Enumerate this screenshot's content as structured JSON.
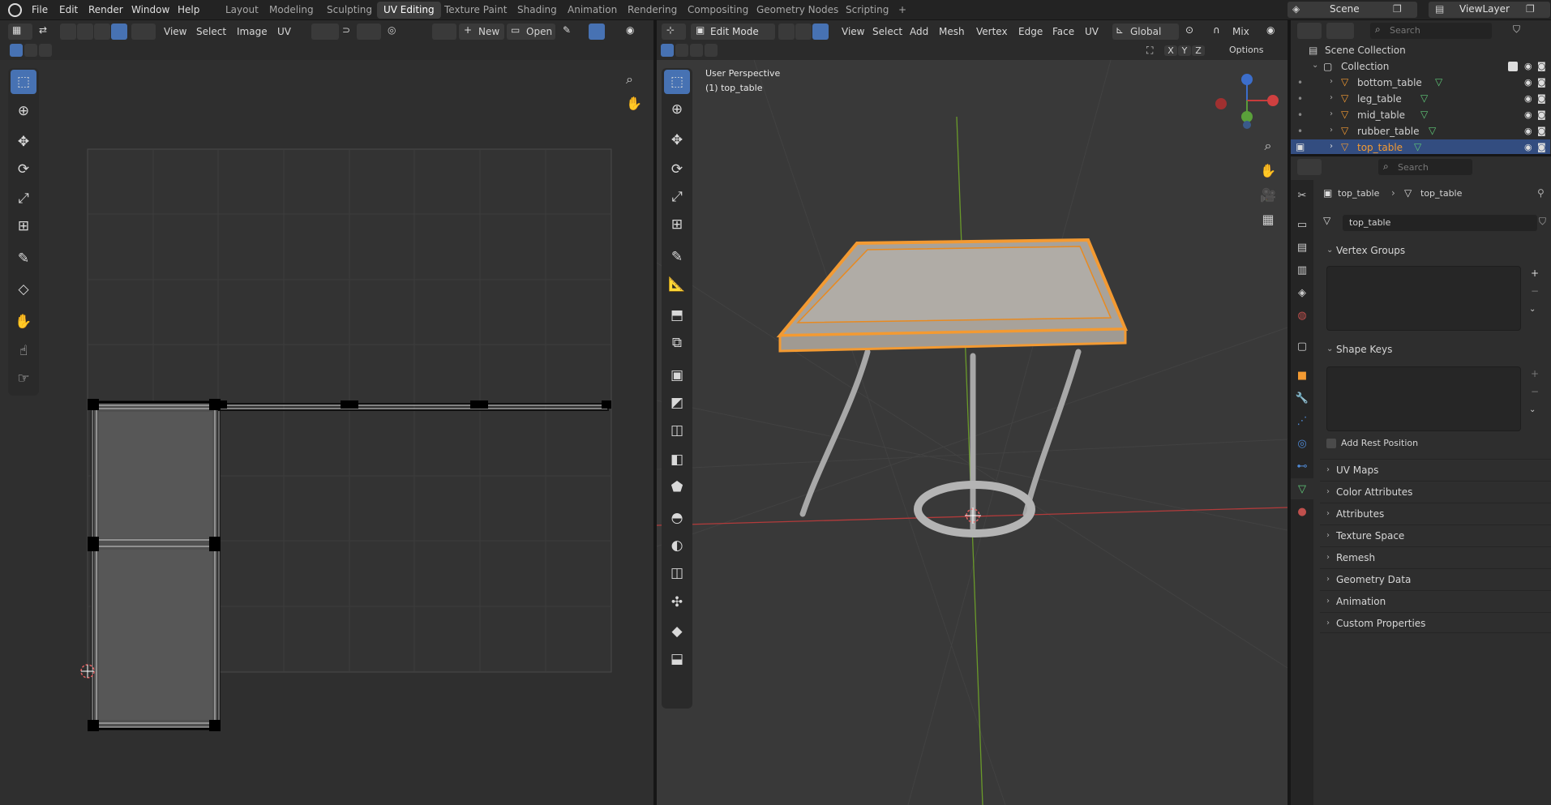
{
  "topbar": {
    "menus": [
      "File",
      "Edit",
      "Render",
      "Window",
      "Help"
    ],
    "workspaces": [
      "Layout",
      "Modeling",
      "Sculpting",
      "UV Editing",
      "Texture Paint",
      "Shading",
      "Animation",
      "Rendering",
      "Compositing",
      "Geometry Nodes",
      "Scripting"
    ],
    "active_workspace": "UV Editing",
    "add_tab": "+",
    "scene_label": "Scene",
    "viewlayer_label": "ViewLayer"
  },
  "uv_editor": {
    "menus": [
      "View",
      "Select",
      "Image",
      "UV"
    ],
    "new_label": "New",
    "open_label": "Open"
  },
  "viewport": {
    "mode_label": "Edit Mode",
    "menus": [
      "View",
      "Select",
      "Add",
      "Mesh",
      "Vertex",
      "Edge",
      "Face",
      "UV"
    ],
    "orientation_label": "Global",
    "mix_label": "Mix",
    "axis_x": "X",
    "axis_y": "Y",
    "axis_z": "Z",
    "options_label": "Options",
    "perspective_label": "User Perspective",
    "object_label": "(1) top_table"
  },
  "outliner": {
    "search_placeholder": "Search",
    "scene_collection": "Scene Collection",
    "collection": "Collection",
    "objects": [
      "bottom_table",
      "leg_table",
      "mid_table",
      "rubber_table",
      "top_table"
    ],
    "selected_object": "top_table"
  },
  "properties": {
    "search_placeholder": "Search",
    "breadcrumb_object": "top_table",
    "breadcrumb_mesh": "top_table",
    "mesh_name": "top_table",
    "vertex_groups": "Vertex Groups",
    "shape_keys": "Shape Keys",
    "add_rest_position": "Add Rest Position",
    "collapsed_sections": [
      "UV Maps",
      "Color Attributes",
      "Attributes",
      "Texture Space",
      "Remesh",
      "Geometry Data",
      "Animation",
      "Custom Properties"
    ]
  },
  "colors": {
    "accent": "#4772b3",
    "selection_orange": "#f39a32",
    "bg": "#1d1d1d",
    "mesh_green": "#5fc878"
  }
}
